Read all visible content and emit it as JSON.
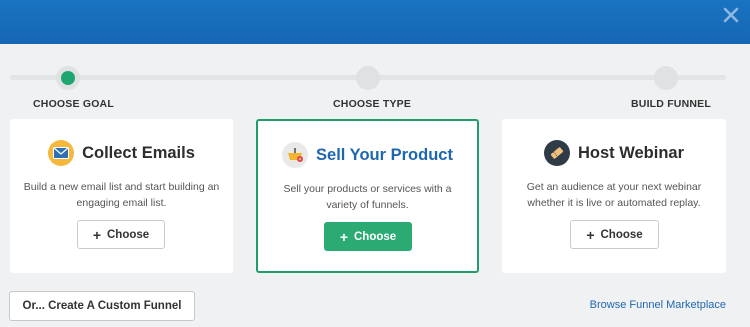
{
  "header": {
    "close_icon": "close-icon"
  },
  "steps": [
    {
      "label": "CHOOSE GOAL",
      "active": true
    },
    {
      "label": "CHOOSE TYPE",
      "active": false
    },
    {
      "label": "BUILD FUNNEL",
      "active": false
    }
  ],
  "cards": [
    {
      "title": "Collect Emails",
      "icon": "envelope-icon",
      "description": "Build a new email list and start building an engaging email list.",
      "button_label": "Choose",
      "selected": false
    },
    {
      "title": "Sell Your Product",
      "icon": "shopping-basket-icon",
      "description": "Sell your products or services with a variety of funnels.",
      "button_label": "Choose",
      "selected": true
    },
    {
      "title": "Host Webinar",
      "icon": "ticket-icon",
      "description": "Get an audience at your next webinar whether it is live or automated replay.",
      "button_label": "Choose",
      "selected": false
    }
  ],
  "footer": {
    "custom_funnel_label": "Or... Create A Custom Funnel",
    "marketplace_link": "Browse Funnel Marketplace"
  },
  "colors": {
    "header_blue": "#1567b3",
    "accent_green": "#2baa74",
    "title_blue": "#1e67b0",
    "link_blue": "#2068b2"
  }
}
